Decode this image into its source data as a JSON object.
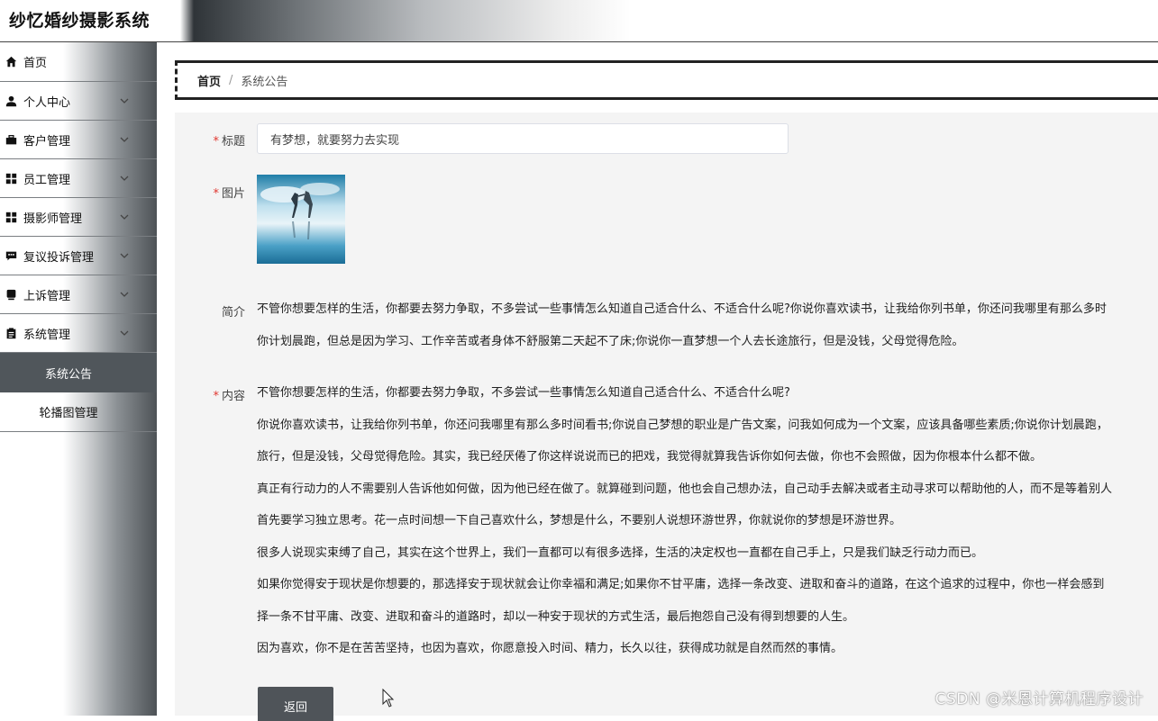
{
  "header": {
    "title": "纱忆婚纱摄影系统"
  },
  "sidebar": {
    "items": [
      {
        "label": "首页",
        "icon": "home-icon"
      },
      {
        "label": "个人中心",
        "icon": "user-icon"
      },
      {
        "label": "客户管理",
        "icon": "briefcase-icon"
      },
      {
        "label": "员工管理",
        "icon": "grid-icon"
      },
      {
        "label": "摄影师管理",
        "icon": "grid-icon"
      },
      {
        "label": "复议投诉管理",
        "icon": "chat-icon"
      },
      {
        "label": "上诉管理",
        "icon": "tablet-icon"
      },
      {
        "label": "系统管理",
        "icon": "clipboard-icon"
      }
    ],
    "submenu": [
      {
        "label": "系统公告",
        "active": true
      },
      {
        "label": "轮播图管理",
        "active": false
      }
    ]
  },
  "breadcrumb": {
    "home": "首页",
    "separator": "/",
    "current": "系统公告"
  },
  "form": {
    "required_mark": "*",
    "title_label": "标题",
    "title_value": "有梦想，就要努力去实现",
    "image_label": "图片",
    "intro_label": "简介",
    "intro_lines": [
      "不管你想要怎样的生活，你都要去努力争取，不多尝试一些事情怎么知道自己适合什么、不适合什么呢?你说你喜欢读书，让我给你列书单，你还问我哪里有那么多时",
      "你计划晨跑，但总是因为学习、工作辛苦或者身体不舒服第二天起不了床;你说你一直梦想一个人去长途旅行，但是没钱，父母觉得危险。"
    ],
    "content_label": "内容",
    "content_lines": [
      "不管你想要怎样的生活，你都要去努力争取，不多尝试一些事情怎么知道自己适合什么、不适合什么呢?",
      "你说你喜欢读书，让我给你列书单，你还问我哪里有那么多时间看书;你说自己梦想的职业是广告文案，问我如何成为一个文案，应该具备哪些素质;你说你计划晨跑，",
      "旅行，但是没钱，父母觉得危险。其实，我已经厌倦了你这样说说而已的把戏，我觉得就算我告诉你如何去做，你也不会照做，因为你根本什么都不做。",
      "真正有行动力的人不需要别人告诉他如何做，因为他已经在做了。就算碰到问题，他也会自己想办法，自己动手去解决或者主动寻求可以帮助他的人，而不是等着别人",
      "首先要学习独立思考。花一点时间想一下自己喜欢什么，梦想是什么，不要别人说想环游世界，你就说你的梦想是环游世界。",
      "很多人说现实束缚了自己，其实在这个世界上，我们一直都可以有很多选择，生活的决定权也一直都在自己手上，只是我们缺乏行动力而已。",
      "如果你觉得安于现状是你想要的，那选择安于现状就会让你幸福和满足;如果你不甘平庸，选择一条改变、进取和奋斗的道路，在这个追求的过程中，你也一样会感到",
      "择一条不甘平庸、改变、进取和奋斗的道路时，却以一种安于现状的方式生活，最后抱怨自己没有得到想要的人生。",
      "因为喜欢，你不是在苦苦坚持，也因为喜欢，你愿意投入时间、精力，长久以往，获得成功就是自然而然的事情。"
    ],
    "back_button": "返回"
  },
  "watermark": "CSDN @米恩计算机程序设计"
}
